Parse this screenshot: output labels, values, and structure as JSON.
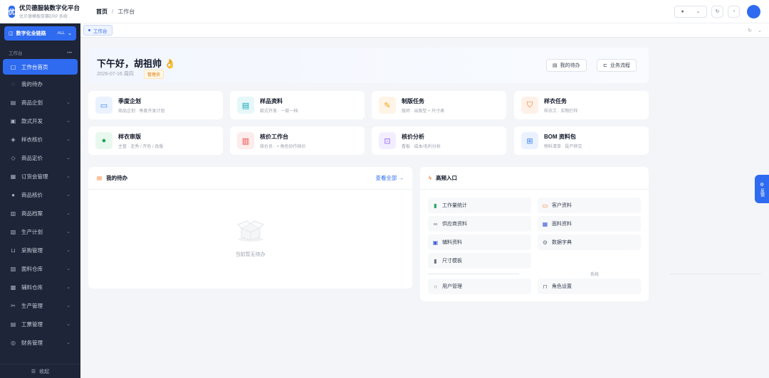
{
  "app": {
    "logo_char": "优",
    "title": "优贝德服装数字化平台",
    "subtitle": "优贝德模板厚赛ERP 系统"
  },
  "switcher": {
    "label": "数字化全链路",
    "scope": "ALL"
  },
  "sidebar": {
    "group": "工作台",
    "items": [
      {
        "label": "工作台首页",
        "icon": "home-icon",
        "glyph": "▢",
        "active": true,
        "chevron": false
      },
      {
        "label": "我的待办",
        "icon": "bell-icon",
        "glyph": "◌",
        "chevron": false
      },
      {
        "label": "商品企划",
        "icon": "calendar-icon",
        "glyph": "▤",
        "chevron": true
      },
      {
        "label": "款式开发",
        "icon": "image-icon",
        "glyph": "▣",
        "chevron": true
      },
      {
        "label": "样衣核价",
        "icon": "tag-icon",
        "glyph": "◈",
        "chevron": true
      },
      {
        "label": "商品定价",
        "icon": "price-tag-icon",
        "glyph": "◇",
        "chevron": true
      },
      {
        "label": "订货会管理",
        "icon": "calendar-icon",
        "glyph": "▦",
        "chevron": true
      },
      {
        "label": "商品核价",
        "icon": "user-icon",
        "glyph": "●",
        "chevron": true
      },
      {
        "label": "商品档案",
        "icon": "archive-icon",
        "glyph": "▥",
        "chevron": true
      },
      {
        "label": "生产计划",
        "icon": "clipboard-icon",
        "glyph": "▧",
        "chevron": true
      },
      {
        "label": "采购管理",
        "icon": "cart-icon",
        "glyph": "⊔",
        "chevron": true
      },
      {
        "label": "面料仓库",
        "icon": "warehouse-icon",
        "glyph": "▨",
        "chevron": true
      },
      {
        "label": "辅料仓库",
        "icon": "box-icon",
        "glyph": "▩",
        "chevron": true
      },
      {
        "label": "生产管理",
        "icon": "scissors-icon",
        "glyph": "✂",
        "chevron": true
      },
      {
        "label": "工票管理",
        "icon": "ticket-icon",
        "glyph": "▤",
        "chevron": true
      },
      {
        "label": "财务管理",
        "icon": "finance-icon",
        "glyph": "◎",
        "chevron": true
      }
    ],
    "collapse_label": "收起"
  },
  "header": {
    "crumb_home": "首页",
    "crumb_sep": "/",
    "crumb_current": "工作台"
  },
  "tabs": [
    {
      "label": "工作台"
    }
  ],
  "hero": {
    "greeting": "下午好，胡祖帅 👌",
    "date": "2026-07-16 周四",
    "role": "管理员",
    "btn_todo": "我的待办",
    "btn_flow": "业务流程"
  },
  "cards": [
    {
      "title": "季度企划",
      "sub": "商品企划 · 季度开发计划",
      "icon": "briefcase-icon",
      "glyph": "▭",
      "color": "#3b82f6",
      "bg": "#eaf2ff"
    },
    {
      "title": "样品资料",
      "sub": "款式开发 · 一款一档",
      "icon": "document-icon",
      "glyph": "▤",
      "color": "#0ea5b7",
      "bg": "#e6f7fa"
    },
    {
      "title": "制版任务",
      "sub": "版师 · 出版型 + 尺寸表",
      "icon": "pen-icon",
      "glyph": "✎",
      "color": "#f59e0b",
      "bg": "#fff4e5"
    },
    {
      "title": "样衣任务",
      "sub": "样衣工 · 实物打样",
      "icon": "shirt-icon",
      "glyph": "⛉",
      "color": "#f97316",
      "bg": "#fff1e8"
    },
    {
      "title": "样衣审版",
      "sub": "主管 · 走秀 / 齐色 / 改版",
      "icon": "person-icon",
      "glyph": "●",
      "color": "#22a55b",
      "bg": "#e9f8ee"
    },
    {
      "title": "核价工作台",
      "sub": "核价员 · + 角色协作核价",
      "icon": "calculator-icon",
      "glyph": "▥",
      "color": "#ef4444",
      "bg": "#fdecec"
    },
    {
      "title": "核价分析",
      "sub": "看板 · 成本/毛利分析",
      "icon": "chart-icon",
      "glyph": "⊡",
      "color": "#8b5cf6",
      "bg": "#f3eeff"
    },
    {
      "title": "BOM 资料包",
      "sub": "物料清单 · 投产移交",
      "icon": "package-icon",
      "glyph": "⊞",
      "color": "#3b82f6",
      "bg": "#eaf2ff"
    }
  ],
  "todo_panel": {
    "title": "我的待办",
    "more": "查看全部 →",
    "empty": "当前暂无待办"
  },
  "quick_panel": {
    "title": "高频入口",
    "items": [
      {
        "label": "工作量统计",
        "icon": "bar-chart-icon",
        "glyph": "▮",
        "color": "#22a55b"
      },
      {
        "label": "客户资料",
        "icon": "id-card-icon",
        "glyph": "▭",
        "color": "#f97316"
      },
      {
        "label": "供应商资料",
        "icon": "link-icon",
        "glyph": "∞",
        "color": "#6b7280"
      },
      {
        "label": "面料资料",
        "icon": "fabric-icon",
        "glyph": "▦",
        "color": "#3b5bdb"
      },
      {
        "label": "辅料资料",
        "icon": "box-icon",
        "glyph": "▣",
        "color": "#3b5bdb"
      },
      {
        "label": "数据字典",
        "icon": "gear-icon",
        "glyph": "⚙",
        "color": "#6b7280"
      },
      {
        "label": "尺寸模板",
        "icon": "ruler-icon",
        "glyph": "▮",
        "color": "#6b7280"
      }
    ],
    "system_label": "系统",
    "system_items": [
      {
        "label": "用户管理",
        "icon": "user-icon",
        "glyph": "○",
        "color": "#6b7280"
      },
      {
        "label": "角色设置",
        "icon": "lock-icon",
        "glyph": "⊓",
        "color": "#6b7280"
      }
    ]
  },
  "fab": {
    "label": "反馈"
  }
}
